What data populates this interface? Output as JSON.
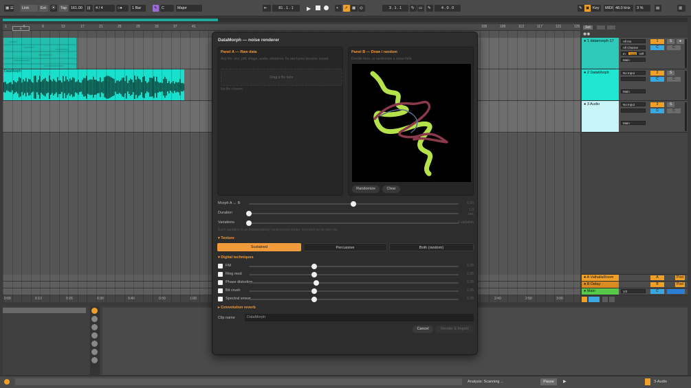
{
  "toolbar": {
    "link": "Link",
    "ext": "Ext",
    "tap": "Tap",
    "tempo": "161.00",
    "sig_num": "4",
    "sig_den": "4",
    "quant": "1 Bar",
    "key": "C",
    "scale": "Major",
    "pos": "81 .  1 .  1",
    "loop_start": "3 .  1 .  1",
    "loop_len": "4 .  0 .  0",
    "key_btn": "Key",
    "midi_btn": "MIDI",
    "sample_rate": "48.0 kHz",
    "cpu": "3 %"
  },
  "ruler": [
    "1",
    "5",
    "9",
    "13",
    "17",
    "21",
    "25",
    "29",
    "33",
    "37",
    "41",
    "105",
    "109",
    "113",
    "117",
    "121",
    "125"
  ],
  "ruler_box": "5",
  "time_labels": [
    "0:00",
    "0:10",
    "0:20",
    "0:30",
    "0:40",
    "0:50",
    "1:00",
    "2:40",
    "2:50",
    "3:00"
  ],
  "page_num": "2/1",
  "tracks": [
    {
      "name": "1 datamorph-17",
      "in": "All Ins",
      "chan": "All Channe",
      "mon": [
        "In",
        "Auto",
        "Off"
      ],
      "out": "Main",
      "num": "1",
      "solo": "S",
      "color": "#2ec9b8"
    },
    {
      "name": "2 DataMorph",
      "in": "No Input",
      "out": "Main",
      "num": "2",
      "solo": "S",
      "color": "#1ee6d0"
    },
    {
      "name": "3 Audio",
      "in": "No Input",
      "out": "Main",
      "num": "3",
      "solo": "S",
      "color": "#c8f4f8"
    }
  ],
  "returns": [
    {
      "name": "A ValhallaRoom",
      "letter": "A",
      "post": "Post",
      "color": "#f0a028"
    },
    {
      "name": "B Delay",
      "letter": "B",
      "post": "Post",
      "color": "#d98a20"
    },
    {
      "name": "Main",
      "out": "1/2",
      "color": "#58c84a"
    }
  ],
  "set_btn": "Set",
  "clip_label": "DataMorph",
  "status": {
    "analysis": "Analysis: Scanning ...",
    "pause": "Pause",
    "track": "3-Audio"
  },
  "dialog": {
    "title": "DataMorph — noise renderer",
    "panel_a": {
      "title": "Panel A — Raw data",
      "subtitle": "Any file: doc, pdf, image, audio, whatever. Its raw bytes become sound.",
      "drop": "Drag a file here",
      "status": "No file chosen"
    },
    "panel_b": {
      "title": "Panel B — Draw / random",
      "subtitle": "Doodle here, or randomize a noise field.",
      "randomize": "Randomize",
      "clear": "Clear"
    },
    "sliders": [
      {
        "label": "Morph A ↔ B",
        "value": "0.50",
        "pos": 0.5
      },
      {
        "label": "Duration",
        "value": "1.0\nsec",
        "pos": 0.0
      },
      {
        "label": "Variations",
        "value": "1 variation",
        "pos": 0.0
      }
    ],
    "variations_note": "Each variation is an independently randomized render, imported as its own clip",
    "texture": {
      "title": "Texture",
      "options": [
        "Sustained",
        "Percussive",
        "Both (random)"
      ],
      "selected": 0
    },
    "digital": {
      "title": "Digital techniques",
      "items": [
        {
          "label": "FM",
          "value": "0.35",
          "pos": 0.31
        },
        {
          "label": "Ring mod",
          "value": "0.35",
          "pos": 0.31
        },
        {
          "label": "Phase distortion",
          "value": "0.35",
          "pos": 0.32
        },
        {
          "label": "Bit crush",
          "value": "0.35",
          "pos": 0.31
        },
        {
          "label": "Spectral smear",
          "value": "0.35",
          "pos": 0.31
        }
      ]
    },
    "reverb": {
      "title": "Convolution reverb"
    },
    "clip_name": {
      "label": "Clip name",
      "value": "DataMorph"
    },
    "cancel": "Cancel",
    "render": "Render & Import"
  }
}
